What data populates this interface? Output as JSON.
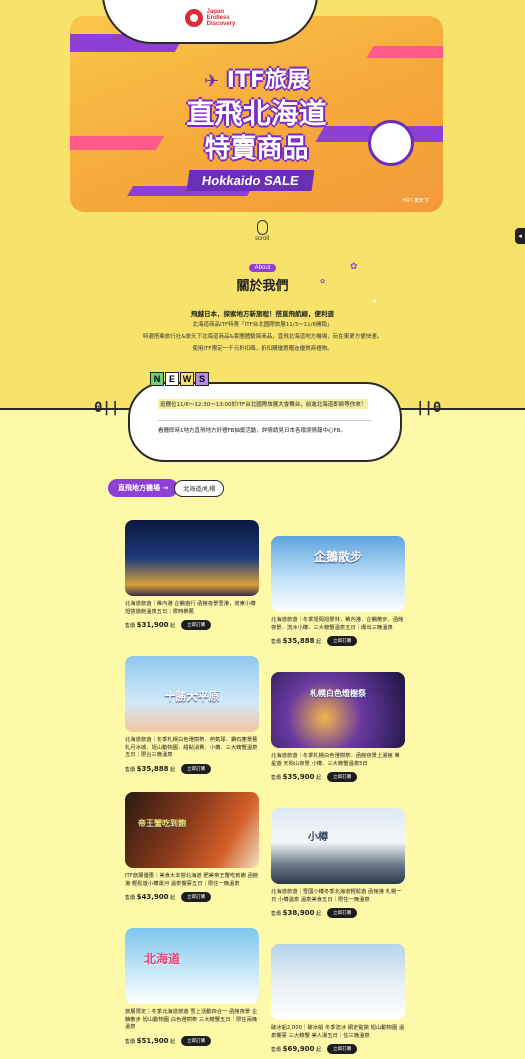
{
  "header": {
    "logo_line1": "Japan",
    "logo_line2": "Endless",
    "logo_line3": "Discovery"
  },
  "banner": {
    "line1": "ITF旅展",
    "line2": "直飛北海道",
    "line3": "特賣商品",
    "sale": "Hokkaido SALE",
    "brand": "HRT 旅天下"
  },
  "scroll": {
    "label": "scroll"
  },
  "about": {
    "tag": "About",
    "heading": "關於我們",
    "headline": "飛越日本，探索地方新旅程！搭直飛航線，便利遊",
    "lines": [
      "北海道商品ITF特賣「ITF台北國際旅展11/3～11/6開跑」",
      "特選搭乘旅行社&旅天下北海道商品&套團體驗兩商品，直飛北海道地方機場，玩在東更方便快速。",
      "使用ITF限定一千元折扣碼，折扣購優惠贈送優質商禮物。"
    ]
  },
  "news": {
    "letters": [
      "N",
      "E",
      "W",
      "S"
    ],
    "items": [
      "逛攤位11/6～12:30～13:00於ITF台北國際旅展大會舞台，前進北海道即將等你來！",
      "看攤即時1地方直飛地方好禮FB抽獎活動，詳情請見日本各環境情報中心FB。"
    ]
  },
  "section": {
    "title": "直飛地方機場 →",
    "subtitle": "北海道/札幌"
  },
  "products": [
    {
      "img_label": "",
      "desc": "北海道旅遊｜稚內港 企鵝遊行 函館夜景雪港，道東小樽 旭營旅館溫泉五日｜限時推薦",
      "price": "$31,900",
      "btn": "立即訂購"
    },
    {
      "img_label": "企鵝散步",
      "desc": "北海道旅遊｜冬季旭岡旭景林，稚內港．企鵝散步．函館夜景．流冰小樽．三大螃蟹溫泉五日｜爆出三晚溫泉",
      "price": "$35,888",
      "btn": "立即訂購"
    },
    {
      "img_label": "十勝大平原",
      "desc": "北海道旅遊｜冬季札幌白色燈樹祭．熱氣球．鑽石塵景藝札月冰城．旭山動物園．甜點消費．小樽．三大螃蟹溫泉五日｜限台三晚溫泉",
      "price": "$35,888",
      "btn": "立即訂購"
    },
    {
      "img_label": "札幌白色燈樹祭",
      "desc": "北海道旅遊｜冬季札幌白色燈樹祭．函館夜景上湯館 單星遊 天狗山夜景 小樽．三大螃蟹溫泉5日",
      "price": "$35,900",
      "btn": "立即訂購"
    },
    {
      "img_label": "帝王蟹吃到飽",
      "desc": "ITF旅展優惠｜美食大本營北海道 肥美帝王蟹吃到飽 函館港 輕鬆遊小樽運河 溫泉饗宴五日｜限住一晚溫泉",
      "price": "$43,900",
      "btn": "立即訂購"
    },
    {
      "img_label": "小樽",
      "desc": "北海道旅遊｜雪國小樽冬季北海道輕鬆遊 函館港 札幌一日 小樽溫泉 溫泉美食五日｜限住一晚溫泉",
      "price": "$38,900",
      "btn": "立即訂購"
    },
    {
      "img_label": "北海道",
      "desc": "旅展限定｜冬季北海道旅遊 雪上活動四合一 函館夜景 企鵝散步 旭山動物園 白色燈樹祭 三大螃蟹五日｜限住兩晚溫泉",
      "price": "$51,900",
      "btn": "立即訂購"
    },
    {
      "img_label": "",
      "desc": "破冰船2,000｜破冰船 冬季流冰 網走監獄 旭山動物園 溫泉饗宴 三大螃蟹 美人湯五日｜住三晚溫泉",
      "price": "$69,900",
      "btn": "立即訂購"
    }
  ]
}
